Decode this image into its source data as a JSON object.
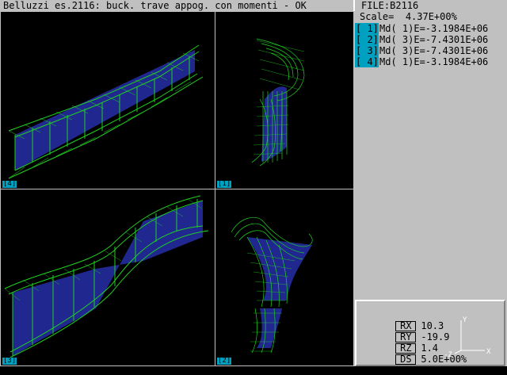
{
  "header": {
    "title": "Belluzzi es.2116: buck. trave appog. con momenti - OK",
    "file": "FILE:B2116"
  },
  "side": {
    "scale_label": "Scale=",
    "scale_value": "4.37E+00%",
    "modes": [
      {
        "index": "[ 1]",
        "text": "Md( 1)E=-3.1984E+06"
      },
      {
        "index": "[ 2]",
        "text": "Md( 3)E=-7.4301E+06"
      },
      {
        "index": "[ 3]",
        "text": "Md( 3)E=-7.4301E+06"
      },
      {
        "index": "[ 4]",
        "text": "Md( 1)E=-3.1984E+06"
      }
    ]
  },
  "viewports": [
    {
      "label": "[4]"
    },
    {
      "label": "[1]"
    },
    {
      "label": "[3]"
    },
    {
      "label": "[2]"
    }
  ],
  "readout": {
    "rows": [
      {
        "key": "RX",
        "value": "10.3"
      },
      {
        "key": "RY",
        "value": "-19.9"
      },
      {
        "key": "RZ",
        "value": "1.4"
      },
      {
        "key": "DS",
        "value": "5.0E+00%"
      }
    ],
    "axes": {
      "y": "Y",
      "x": "X",
      "z": "-Z"
    }
  },
  "colors": {
    "mesh_green": "#20d020",
    "web_blue": "#202890",
    "panel_gray": "#c0c0c0",
    "label_cyan": "#00a0c0"
  }
}
